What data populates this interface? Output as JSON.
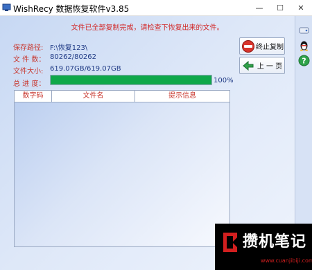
{
  "window": {
    "title": "WishRecy 数据恢复软件v3.85",
    "controls": [
      "—",
      "☐",
      "✕"
    ]
  },
  "status_message": "文件已全部复制完成，请检查下恢复出来的文件。",
  "info": {
    "save_path_label": "保存路径:",
    "save_path_value": "F:\\恢复123\\",
    "file_count_label": "文 件 数：",
    "file_count_value": "80262/80262",
    "file_size_label": "文件大小:",
    "file_size_value": "619.07GB/619.07GB",
    "progress_label": "总 进 度：",
    "progress_value": 1.0,
    "progress_text": "100%"
  },
  "table": {
    "columns": [
      "数字码",
      "文件名",
      "提示信息"
    ],
    "rows": []
  },
  "buttons": {
    "stop_label": "终止复制",
    "prev_label": "上 一 页"
  },
  "side_icons": [
    "drive-icon",
    "qq-penguin-icon",
    "help-icon"
  ],
  "watermark": {
    "text": "攒机笔记",
    "url": "www.cuanjibiji.com"
  },
  "colors": {
    "label_red": "#c8362d",
    "value_blue": "#1f3a85",
    "progress_green": "#0fa84a",
    "status_red": "#d22a2a"
  }
}
